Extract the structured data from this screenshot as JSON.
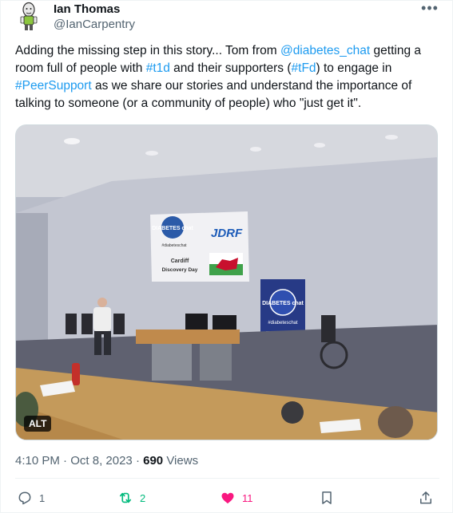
{
  "author": {
    "display_name": "Ian Thomas",
    "handle": "@IanCarpentry",
    "avatar_icon": "cartoon-avatar-icon",
    "more_label": "•••"
  },
  "tweet": {
    "segments": [
      {
        "text": "Adding the missing step in this story... Tom from ",
        "type": "text"
      },
      {
        "text": "@diabetes_chat",
        "type": "link"
      },
      {
        "text": " getting a room full of people with ",
        "type": "text"
      },
      {
        "text": "#t1d",
        "type": "link"
      },
      {
        "text": " and their supporters (",
        "type": "text"
      },
      {
        "text": "#tFd",
        "type": "link"
      },
      {
        "text": ") to engage in ",
        "type": "text"
      },
      {
        "text": "#PeerSupport",
        "type": "link"
      },
      {
        "text": " as we share our stories and understand the importance of talking to someone (or a community of people) who \"just get it\".",
        "type": "text"
      }
    ]
  },
  "media": {
    "alt_label": "ALT",
    "slide_diabetes_chat": "DIABETES chat",
    "slide_jdrf": "JDRF",
    "slide_hashtag": "#diabeteschat",
    "slide_cardiff": "Cardiff",
    "slide_discovery": "Discovery Day",
    "banner_title": "DIABETES chat",
    "banner_hashtag": "#diabeteschat"
  },
  "meta": {
    "time": "4:10 PM",
    "separator": "·",
    "date": "Oct 8, 2023",
    "views_count": "690",
    "views_label": "Views"
  },
  "actions": {
    "reply_count": "1",
    "retweet_count": "2",
    "like_count": "11",
    "icons": [
      "reply-icon",
      "retweet-icon",
      "like-icon",
      "bookmark-icon",
      "share-icon"
    ],
    "colors": {
      "retweet": "#00ba7c",
      "like": "#f91880",
      "link": "#1d9bf0",
      "muted": "#536471"
    }
  }
}
